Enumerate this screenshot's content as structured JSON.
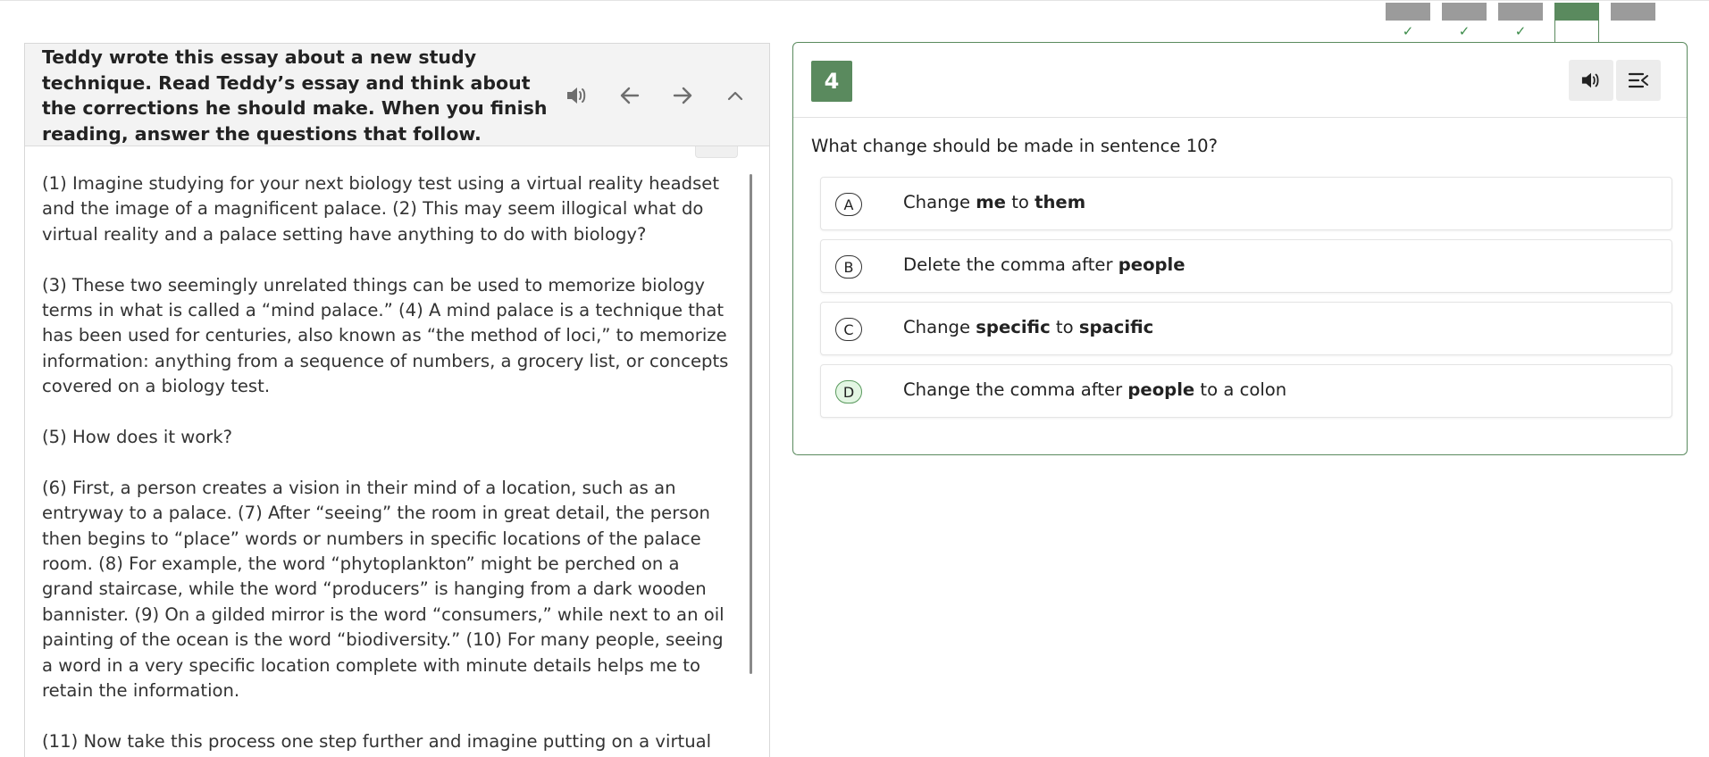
{
  "progress": {
    "tabs": [
      {
        "label": "",
        "status": "complete",
        "check": "✓"
      },
      {
        "label": "",
        "status": "complete",
        "check": "✓"
      },
      {
        "label": "",
        "status": "complete",
        "check": "✓"
      },
      {
        "label": "",
        "status": "current",
        "check": ""
      },
      {
        "label": "",
        "status": "unvisited",
        "check": ""
      }
    ],
    "colors": {
      "done": "#9b9b9b",
      "current": "#5a8a5e",
      "check": "#3c8c4a"
    }
  },
  "passage": {
    "title": "Teddy wrote this essay about a new study technique. Read Teddy’s essay and think about the corrections he should make. When you finish reading, answer the questions that follow.",
    "controls": {
      "audio": "speaker-icon",
      "back": "arrow-left-icon",
      "forward": "arrow-right-icon",
      "collapse": "chevron-up-icon"
    },
    "paragraphs": [
      [
        "(1) Imagine studying for your next biology test using a virtual reality headset",
        "and the image of a magnificent palace. (2) This may seem illogical what do",
        "virtual reality and a palace setting have anything to do with biology?"
      ],
      [
        "(3) These two seemingly unrelated things can be used to memorize biology",
        "terms in what is called a “mind palace.” (4) A mind palace is a technique that",
        "has been used for centuries, also known as “the method of loci,” to memorize",
        "information: anything from a sequence of numbers, a grocery list, or concepts",
        "covered on a biology test."
      ],
      [
        "(5) How does it work?"
      ],
      [
        "(6) First, a person creates a vision in their mind of a location, such as an",
        "entryway to a palace. (7) After “seeing” the room in great detail, the person",
        "then begins to “place” words or numbers in specific locations of the palace",
        "room. (8) For example, the word “phytoplankton” might be perched on a",
        "grand staircase, while the word “producers” is hanging from a dark wooden",
        "bannister. (9) On a gilded mirror is the word “consumers,” while next to an oil",
        "painting of the ocean is the word “biodiversity.” (10) For many people, seeing",
        "a word in a very specific location complete with minute details helps me to",
        "retain the information."
      ],
      [
        "(11) Now take this process one step further and imagine putting on a virtual"
      ]
    ]
  },
  "question": {
    "number": "4",
    "prompt": "What change should be made in sentence 10?",
    "controls": {
      "audio": "speaker-icon",
      "menu": "line-reader-icon"
    },
    "accent": "#5a8a5e",
    "options": [
      {
        "letter": "A",
        "parts": [
          {
            "t": "Change ",
            "b": false
          },
          {
            "t": "me",
            "b": true
          },
          {
            "t": " to ",
            "b": false
          },
          {
            "t": "them",
            "b": true
          }
        ]
      },
      {
        "letter": "B",
        "parts": [
          {
            "t": "Delete the comma after ",
            "b": false
          },
          {
            "t": "people",
            "b": true
          }
        ]
      },
      {
        "letter": "C",
        "parts": [
          {
            "t": "Change ",
            "b": false
          },
          {
            "t": "specific",
            "b": true
          },
          {
            "t": " to ",
            "b": false
          },
          {
            "t": "spacific",
            "b": true
          }
        ]
      },
      {
        "letter": "D",
        "highlighted": true,
        "parts": [
          {
            "t": "Change the comma after ",
            "b": false
          },
          {
            "t": "people",
            "b": true
          },
          {
            "t": " to a colon",
            "b": false
          }
        ]
      }
    ]
  }
}
